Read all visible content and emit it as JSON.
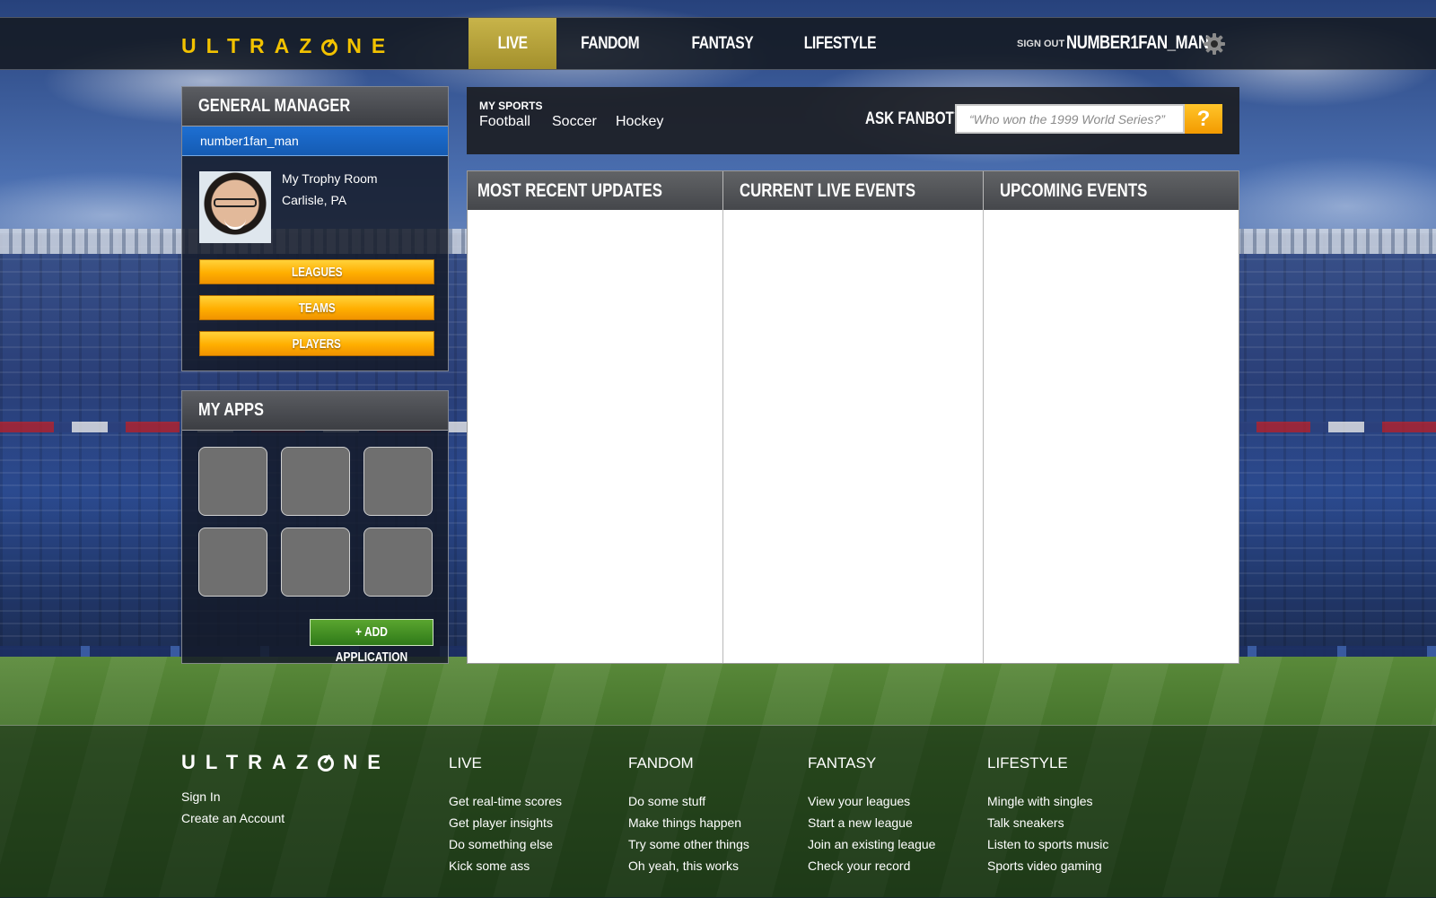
{
  "colors": {
    "brand_gold": "#f2c200",
    "nav_active": "#b8a53b",
    "user_blue": "#1d6fd2",
    "button_orange": "#ffae00",
    "add_green": "#3f8f22"
  },
  "header": {
    "logo": "ULTRAZONE",
    "tabs": [
      {
        "label": "LIVE",
        "active": true
      },
      {
        "label": "FANDOM",
        "active": false
      },
      {
        "label": "FANTASY",
        "active": false
      },
      {
        "label": "LIFESTYLE",
        "active": false
      }
    ],
    "sign_out": "SIGN OUT",
    "username": "NUMBER1FAN_MAN",
    "settings_icon": "gear-icon"
  },
  "general_manager": {
    "title": "GENERAL MANAGER",
    "username": "number1fan_man",
    "trophy_room": "My Trophy Room",
    "location": "Carlisle, PA",
    "buttons": [
      "LEAGUES",
      "TEAMS",
      "PLAYERS"
    ]
  },
  "my_apps": {
    "title": "MY APPS",
    "tile_count": 6,
    "add_button": "+ ADD APPLICATION"
  },
  "my_sports": {
    "label": "MY SPORTS",
    "sports": [
      "Football",
      "Soccer",
      "Hockey"
    ]
  },
  "fanbot": {
    "label": "ASK FANBOT™",
    "placeholder": "“Who won the 1999 World Series?”",
    "button": "?"
  },
  "columns": [
    {
      "title": "MOST RECENT UPDATES"
    },
    {
      "title": "CURRENT LIVE EVENTS"
    },
    {
      "title": "UPCOMING EVENTS"
    }
  ],
  "footer": {
    "logo": "ULTRAZONE",
    "account_links": [
      "Sign In",
      "Create an Account"
    ],
    "sections": [
      {
        "title": "LIVE",
        "links": [
          "Get real-time scores",
          "Get player insights",
          "Do something else",
          "Kick some ass"
        ]
      },
      {
        "title": "FANDOM",
        "links": [
          "Do some stuff",
          "Make things happen",
          "Try some other things",
          "Oh yeah, this works"
        ]
      },
      {
        "title": "FANTASY",
        "links": [
          "View your leagues",
          "Start a new league",
          "Join an existing league",
          "Check your record"
        ]
      },
      {
        "title": "LIFESTYLE",
        "links": [
          "Mingle with singles",
          "Talk sneakers",
          "Listen to sports music",
          "Sports video gaming"
        ]
      }
    ]
  }
}
